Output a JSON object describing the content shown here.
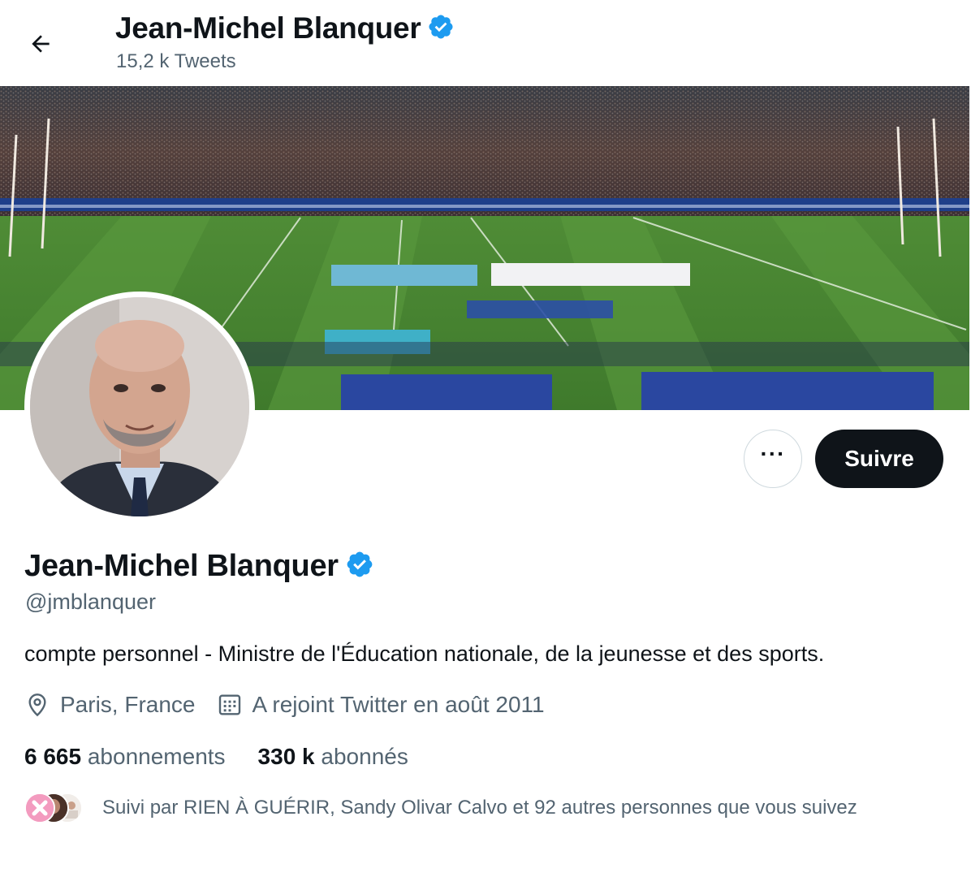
{
  "header": {
    "name": "Jean-Michel Blanquer",
    "tweet_count": "15,2 k Tweets",
    "back_icon": "arrow-left-icon"
  },
  "profile": {
    "name": "Jean-Michel Blanquer",
    "verified_icon": "verified-badge-icon",
    "handle": "@jmblanquer",
    "bio": "compte personnel - Ministre de l'Éducation nationale, de la jeunesse et des sports.",
    "location": "Paris, France",
    "location_icon": "location-pin-icon",
    "joined": "A rejoint Twitter en août 2011",
    "joined_icon": "calendar-icon"
  },
  "actions": {
    "more_label": "···",
    "follow_label": "Suivre"
  },
  "stats": {
    "following_count": "6 665",
    "following_label": "abonnements",
    "followers_count": "330 k",
    "followers_label": "abonnés"
  },
  "followed_by": {
    "text": "Suivi par RIEN À GUÉRIR, Sandy Olivar Calvo et 92 autres personnes que vous suivez"
  },
  "colors": {
    "primary_text": "#0f1419",
    "secondary_text": "#536471",
    "verified": "#1d9bf0",
    "follow_button": "#0f1419",
    "border": "#cfd9de"
  }
}
